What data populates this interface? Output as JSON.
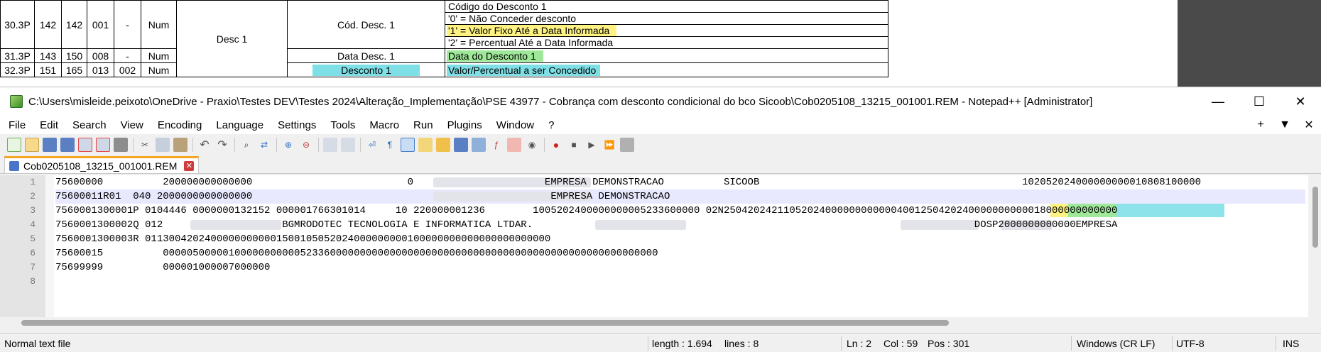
{
  "spec_table": {
    "rows": [
      {
        "pos": "30.3P",
        "ini": "142",
        "fim": "142",
        "dig": "001",
        "dec": "-",
        "tipo": "Num",
        "campo": "Desc 1",
        "nome": "Cód. Desc. 1",
        "desc": [
          "Código do Desconto 1",
          "'0'  =  Não Conceder desconto",
          "'1'  =  Valor Fixo Até a Data Informada",
          "'2'  =  Percentual Até a Data Informada"
        ]
      },
      {
        "pos": "31.3P",
        "ini": "143",
        "fim": "150",
        "dig": "008",
        "dec": "-",
        "tipo": "Num",
        "nome": "Data Desc. 1",
        "desc": "Data do Desconto 1"
      },
      {
        "pos": "32.3P",
        "ini": "151",
        "fim": "165",
        "dig": "013",
        "dec": "002",
        "tipo": "Num",
        "nome": "Desconto 1",
        "desc": "Valor/Percentual a ser Concedido"
      }
    ]
  },
  "window": {
    "title": "C:\\Users\\misleide.peixoto\\OneDrive - Praxio\\Testes DEV\\Testes 2024\\Alteração_Implementação\\PSE 43977 - Cobrança com desconto condicional do bco Sicoob\\Cob0205108_13215_001001.REM - Notepad++ [Administrator]",
    "min": "—",
    "max": "☐",
    "close": "✕"
  },
  "menu": [
    "File",
    "Edit",
    "Search",
    "View",
    "Encoding",
    "Language",
    "Settings",
    "Tools",
    "Macro",
    "Run",
    "Plugins",
    "Window",
    "?"
  ],
  "menu_right": [
    "+",
    "▼",
    "✕"
  ],
  "tab": {
    "label": "Cob0205108_13215_001001.REM"
  },
  "editor": {
    "line_numbers": [
      "1",
      "2",
      "3",
      "4",
      "5",
      "6",
      "7",
      "8"
    ],
    "lines": [
      "75600000          200000000000000                          0                      EMPRESA DEMONSTRACAO          SICOOB                                            102052024000000000010808100000",
      "75600011R01  040 2000000000000000                                                  EMPRESA DEMONSTRACAO",
      "7560001300001P 0104446 0000000132152 000001766301014     10 220000001236        1005202400000000005233600000 02N250420242110520240000000000004001250420240000000000018000000000000",
      "7560001300002Q 012                    BGMRODOTEC TECNOLOGIA E INFORMATICA LTDAR.                                                                          DOSP2000000000000EMPRESA",
      "7560001300003R 01130042024000000000001500105052024000000000100000000000000000000000",
      "75600015          00000500000100000000000523360000000000000000000000000000000000000000000000000000000",
      "75699999          000001000007000000",
      ""
    ]
  },
  "status": {
    "file_type": "Normal text file",
    "length": "length : 1.694",
    "lines": "lines : 8",
    "ln": "Ln : 2",
    "col": "Col : 59",
    "pos": "Pos : 301",
    "eol": "Windows (CR LF)",
    "encoding": "UTF-8",
    "mode": "INS"
  },
  "colors": {
    "highlight_yellow": "#fdf282",
    "highlight_green": "#9fe89a",
    "highlight_cyan": "#8ee3ea",
    "tab_accent": "#f5a623"
  }
}
